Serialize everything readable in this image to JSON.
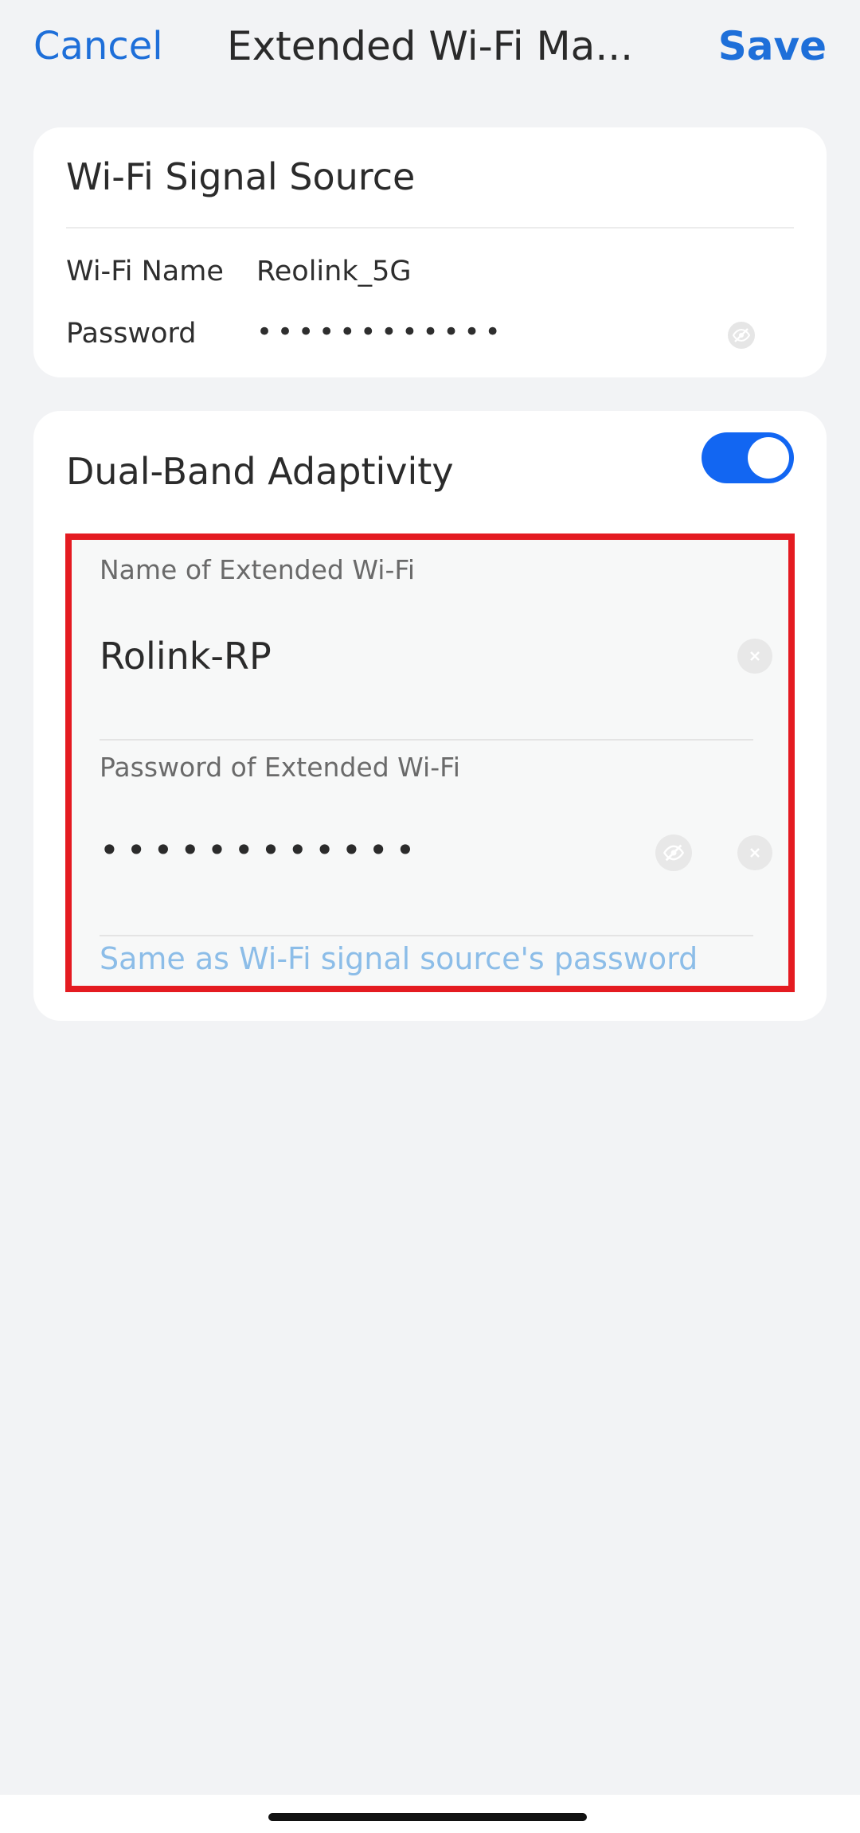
{
  "nav": {
    "cancel_label": "Cancel",
    "title": "Extended Wi-Fi Ma...",
    "save_label": "Save"
  },
  "signal_source": {
    "title": "Wi-Fi Signal Source",
    "wifi_name_label": "Wi-Fi Name",
    "wifi_name_value": "Reolink_5G",
    "password_label": "Password",
    "password_mask": "••••••••••••",
    "visibility_icon": "eye-off-icon"
  },
  "dual_band": {
    "title": "Dual-Band Adaptivity",
    "enabled": true
  },
  "extended": {
    "name_label": "Name of Extended Wi-Fi",
    "name_value": "Rolink-RP",
    "password_label": "Password of Extended Wi-Fi",
    "password_mask": "••••••••••••",
    "same_as_link": "Same as Wi-Fi signal source's password"
  },
  "colors": {
    "accent": "#1e6fd9",
    "toggle_on": "#1266f2",
    "highlight_border": "#e41b21",
    "link_light": "#8cbde8",
    "background": "#f2f3f5"
  }
}
